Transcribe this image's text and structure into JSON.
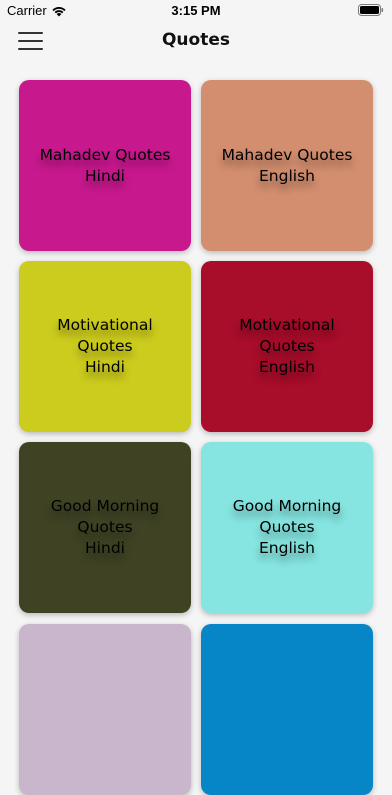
{
  "status_bar": {
    "carrier": "Carrier",
    "time": "3:15 PM"
  },
  "header": {
    "title": "Quotes",
    "menu_icon": "hamburger-menu-icon"
  },
  "tiles": [
    {
      "label": "Mahadev Quotes\nHindi",
      "color": "#C8188E"
    },
    {
      "label": "Mahadev Quotes\nEnglish",
      "color": "#D38E6F"
    },
    {
      "label": "Motivational\nQuotes\nHindi",
      "color": "#CCCC1E"
    },
    {
      "label": "Motivational\nQuotes\nEnglish",
      "color": "#A80D2A"
    },
    {
      "label": "Good Morning\nQuotes\nHindi",
      "color": "#3F4324"
    },
    {
      "label": "Good Morning\nQuotes\nEnglish",
      "color": "#86E5E0"
    },
    {
      "label": "",
      "color": "#C9B5CC"
    },
    {
      "label": "",
      "color": "#0786C7"
    }
  ]
}
